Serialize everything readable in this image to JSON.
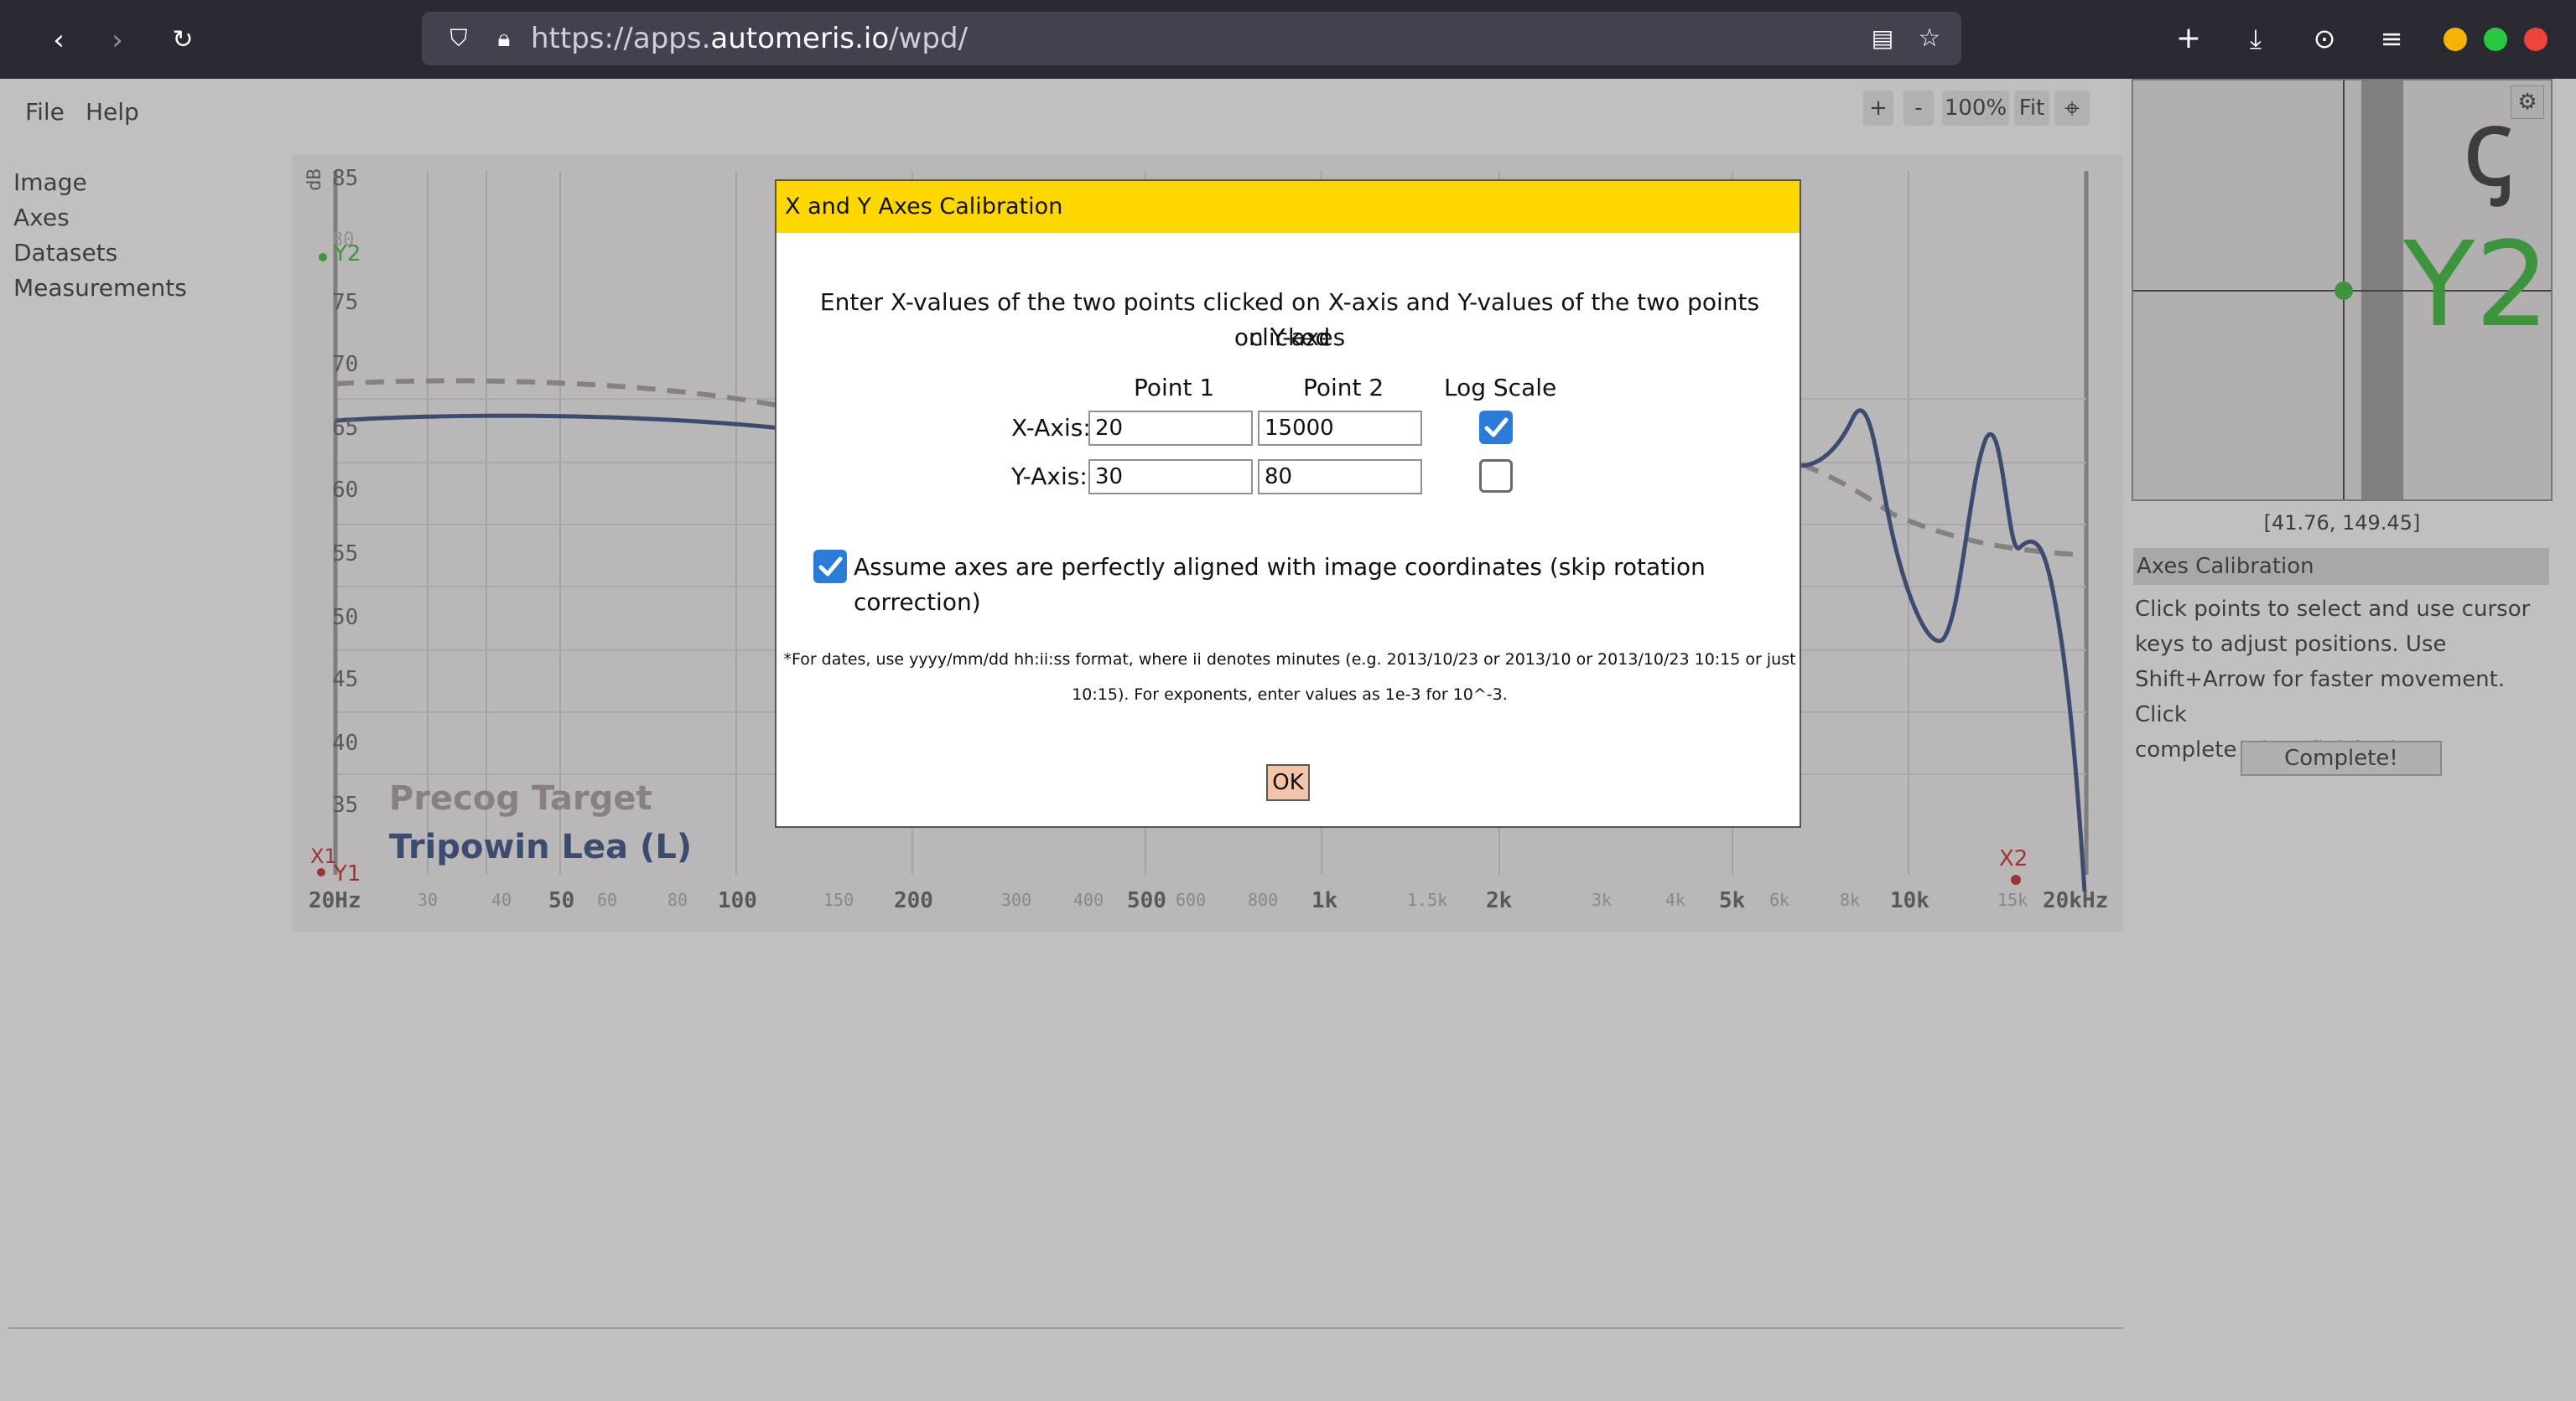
{
  "browser": {
    "url_prefix": "https://apps.",
    "url_domain": "automeris.io",
    "url_path": "/wpd/"
  },
  "menu": {
    "file": "File",
    "help": "Help"
  },
  "sidebar": {
    "items": [
      "Image",
      "Axes",
      "Datasets",
      "Measurements"
    ]
  },
  "zoom": {
    "plus": "+",
    "minus": "-",
    "level": "100%",
    "fit": "Fit"
  },
  "plot": {
    "y_unit": "dB",
    "y_ticks": [
      "85",
      "80",
      "75",
      "70",
      "65",
      "60",
      "55",
      "50",
      "45",
      "40",
      "35"
    ],
    "x_ticks_major": [
      "20Hz",
      "50",
      "100",
      "200",
      "500",
      "1k",
      "2k",
      "5k",
      "10k",
      "20kHz"
    ],
    "x_ticks_minor": [
      "30",
      "40",
      "60",
      "80",
      "150",
      "300",
      "400",
      "600",
      "800",
      "1.5k",
      "3k",
      "4k",
      "6k",
      "8k",
      "15k"
    ],
    "legend_target": "Precog Target",
    "legend_measure": "Tripowin Lea (L)",
    "markers": {
      "x1": "X1",
      "y1": "Y1",
      "y2": "Y2",
      "x2": "X2"
    },
    "colors": {
      "target": "#9a8a88",
      "measure": "#0f2d6e",
      "marker_red": "#c00000",
      "marker_green": "#10b010"
    }
  },
  "magnifier": {
    "label": "Y2",
    "coords": "[41.76, 149.45]"
  },
  "calibration_panel": {
    "title": "Axes Calibration",
    "lines": [
      "Click points to select and use cursor",
      "keys to adjust positions. Use",
      "Shift+Arrow for faster movement. Click",
      "complete when finished."
    ],
    "complete": "Complete!"
  },
  "dialog": {
    "title": "X and Y Axes Calibration",
    "instruction_1": "Enter X-values of the two points clicked on X-axis and Y-values of the two points clicked",
    "instruction_2": "on Y-axes",
    "col_point1": "Point 1",
    "col_point2": "Point 2",
    "col_log": "Log Scale",
    "x_label": "X-Axis:",
    "y_label": "Y-Axis:",
    "x_p1": "20",
    "x_p2": "15000",
    "y_p1": "30",
    "y_p2": "80",
    "x_log": true,
    "y_log": false,
    "assume_aligned": true,
    "assume_label": "Assume axes are perfectly aligned with image coordinates (skip rotation correction)",
    "note_1": "*For dates, use yyyy/mm/dd hh:ii:ss format, where ii denotes minutes (e.g. 2013/10/23 or 2013/10 or 2013/10/23 10:15 or just",
    "note_2": "10:15). For exponents, enter values as 1e-3 for 10^-3.",
    "ok": "OK"
  }
}
